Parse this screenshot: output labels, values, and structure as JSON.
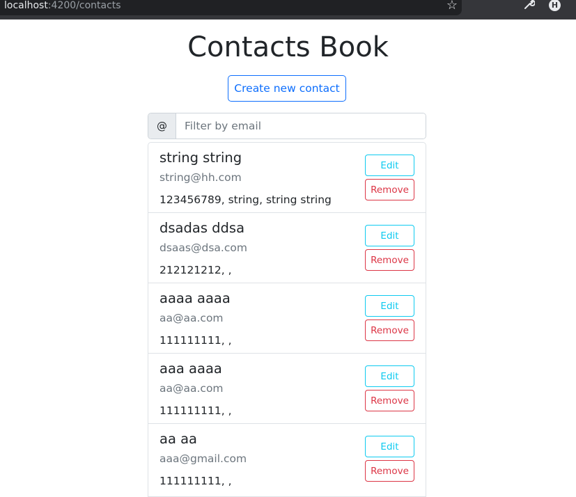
{
  "browser": {
    "url_host": "localhost",
    "url_rest": ":4200/contacts",
    "profile_initial": "H"
  },
  "page": {
    "title": "Contacts Book",
    "create_button": "Create new contact",
    "filter_addon": "@",
    "filter_placeholder": "Filter by email",
    "filter_value": ""
  },
  "contacts": [
    {
      "name": "string string",
      "email": "string@hh.com",
      "details": "123456789, string, string string",
      "edit_label": "Edit",
      "remove_label": "Remove"
    },
    {
      "name": "dsadas ddsa",
      "email": "dsaas@dsa.com",
      "details": "212121212, ,",
      "edit_label": "Edit",
      "remove_label": "Remove"
    },
    {
      "name": "aaaa aaaa",
      "email": "aa@aa.com",
      "details": "111111111, ,",
      "edit_label": "Edit",
      "remove_label": "Remove"
    },
    {
      "name": "aaa aaaa",
      "email": "aa@aa.com",
      "details": "111111111, ,",
      "edit_label": "Edit",
      "remove_label": "Remove"
    },
    {
      "name": "aa aa",
      "email": "aaa@gmail.com",
      "details": "111111111, ,",
      "edit_label": "Edit",
      "remove_label": "Remove"
    }
  ],
  "colors": {
    "primary": "#0d6efd",
    "info": "#0dcaf0",
    "danger": "#dc3545",
    "browser_bar": "#35363a"
  }
}
